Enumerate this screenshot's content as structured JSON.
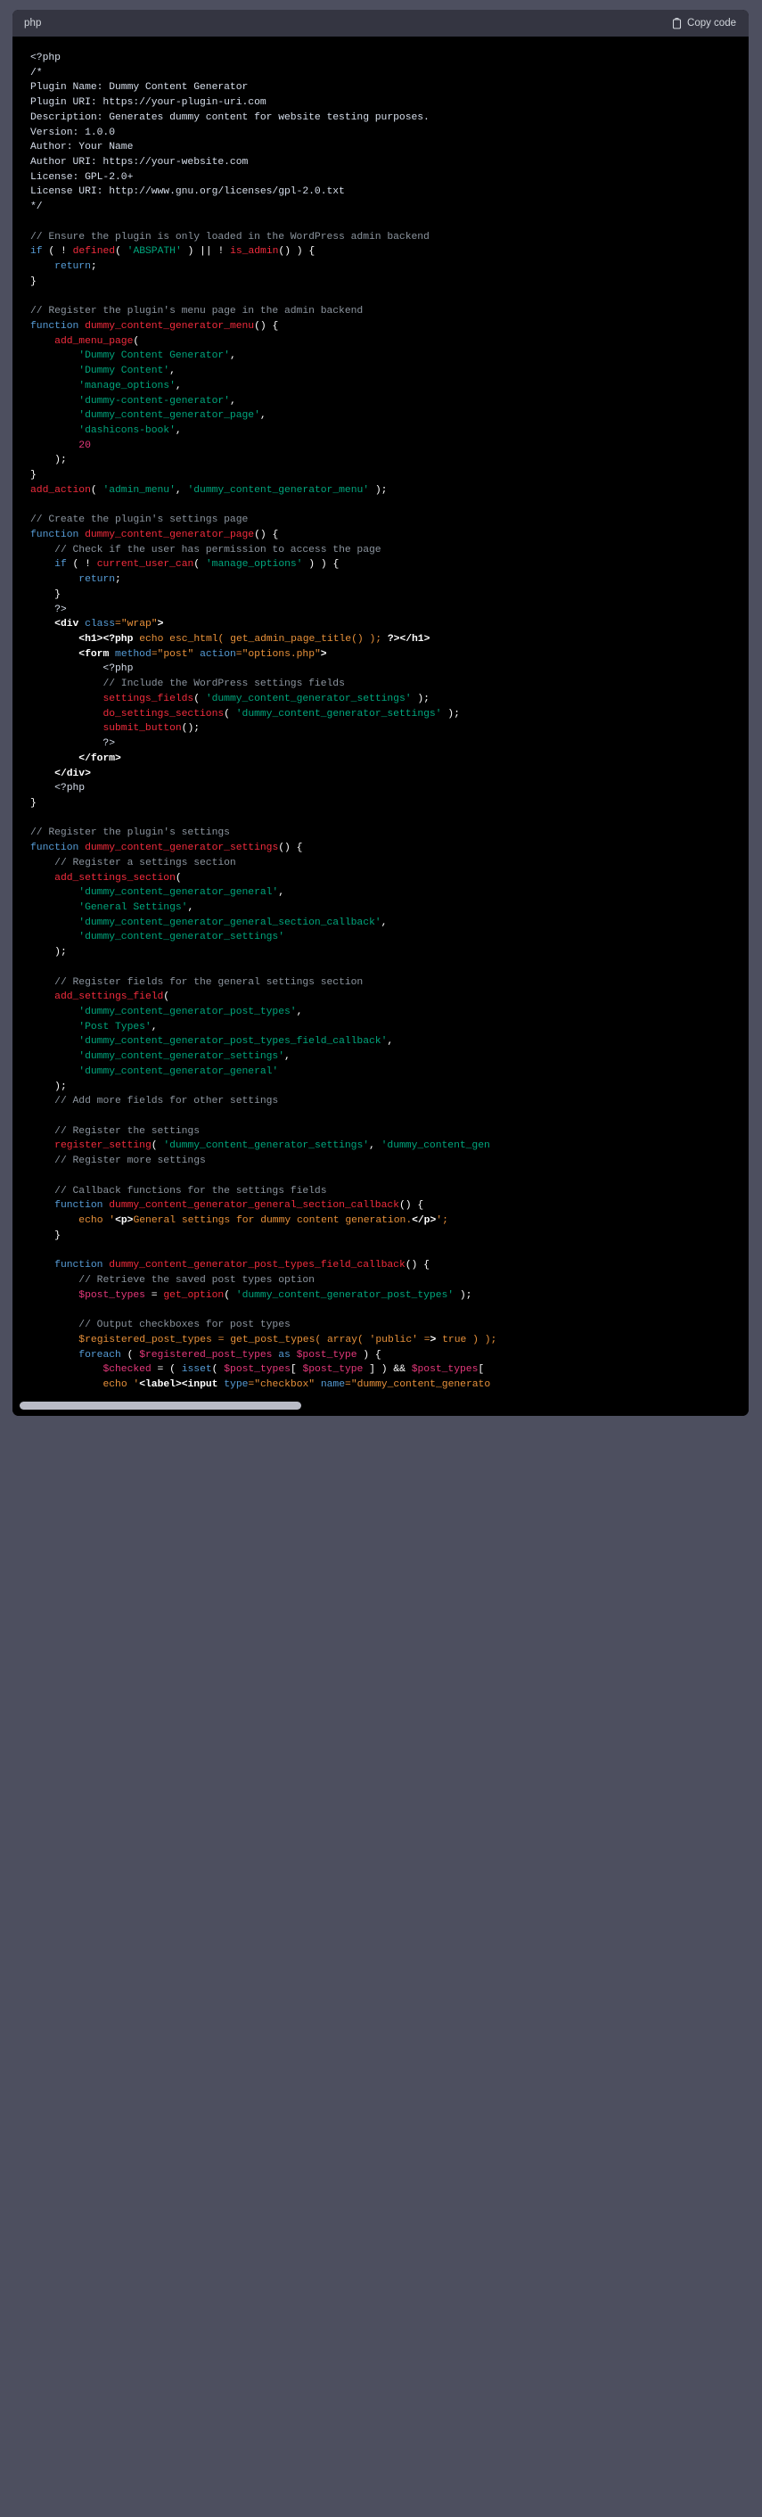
{
  "code_block": {
    "language_label": "php",
    "copy_label": "Copy code",
    "copy_icon": "clipboard-icon",
    "colors": {
      "page_background": "#4d4f5f",
      "header_background": "#343541",
      "body_background": "#000000",
      "comment": "#8b949e",
      "keyword": "#569cd6",
      "function": "#f22c3d",
      "string": "#00a67d",
      "number": "#e5387b",
      "variable": "#e5387b",
      "html_tag": "#ffffff",
      "html_attr": "#569cd6",
      "html_attr_value": "#e8913a",
      "plain_text": "#d6deeb",
      "scrollbar_thumb": "#b9bbc6"
    },
    "scrollbar": {
      "visible": true,
      "thumb_fraction": 0.39
    },
    "code_lines": [
      "<?php",
      "/*",
      "Plugin Name: Dummy Content Generator",
      "Plugin URI: https://your-plugin-uri.com",
      "Description: Generates dummy content for website testing purposes.",
      "Version: 1.0.0",
      "Author: Your Name",
      "Author URI: https://your-website.com",
      "License: GPL-2.0+",
      "License URI: http://www.gnu.org/licenses/gpl-2.0.txt",
      "*/",
      "",
      "// Ensure the plugin is only loaded in the WordPress admin backend",
      "if ( ! defined( 'ABSPATH' ) || ! is_admin() ) {",
      "    return;",
      "}",
      "",
      "// Register the plugin's menu page in the admin backend",
      "function dummy_content_generator_menu() {",
      "    add_menu_page(",
      "        'Dummy Content Generator',",
      "        'Dummy Content',",
      "        'manage_options',",
      "        'dummy-content-generator',",
      "        'dummy_content_generator_page',",
      "        'dashicons-book',",
      "        20",
      "    );",
      "}",
      "add_action( 'admin_menu', 'dummy_content_generator_menu' );",
      "",
      "// Create the plugin's settings page",
      "function dummy_content_generator_page() {",
      "    // Check if the user has permission to access the page",
      "    if ( ! current_user_can( 'manage_options' ) ) {",
      "        return;",
      "    }",
      "    ?>",
      "    <div class=\"wrap\">",
      "        <h1><?php echo esc_html( get_admin_page_title() ); ?></h1>",
      "        <form method=\"post\" action=\"options.php\">",
      "            <?php",
      "            // Include the WordPress settings fields",
      "            settings_fields( 'dummy_content_generator_settings' );",
      "            do_settings_sections( 'dummy_content_generator_settings' );",
      "            submit_button();",
      "            ?>",
      "        </form>",
      "    </div>",
      "    <?php",
      "}",
      "",
      "// Register the plugin's settings",
      "function dummy_content_generator_settings() {",
      "    // Register a settings section",
      "    add_settings_section(",
      "        'dummy_content_generator_general',",
      "        'General Settings',",
      "        'dummy_content_generator_general_section_callback',",
      "        'dummy_content_generator_settings'",
      "    );",
      "",
      "    // Register fields for the general settings section",
      "    add_settings_field(",
      "        'dummy_content_generator_post_types',",
      "        'Post Types',",
      "        'dummy_content_generator_post_types_field_callback',",
      "        'dummy_content_generator_settings',",
      "        'dummy_content_generator_general'",
      "    );",
      "    // Add more fields for other settings",
      "",
      "    // Register the settings",
      "    register_setting( 'dummy_content_generator_settings', 'dummy_content_gen",
      "    // Register more settings",
      "",
      "    // Callback functions for the settings fields",
      "    function dummy_content_generator_general_section_callback() {",
      "        echo '<p>General settings for dummy content generation.</p>';",
      "    }",
      "",
      "    function dummy_content_generator_post_types_field_callback() {",
      "        // Retrieve the saved post types option",
      "        $post_types = get_option( 'dummy_content_generator_post_types' );",
      "",
      "        // Output checkboxes for post types",
      "        $registered_post_types = get_post_types( array( 'public' => true ) );",
      "        foreach ( $registered_post_types as $post_type ) {",
      "            $checked = ( isset( $post_types[ $post_type ] ) && $post_types[",
      "            echo '<label><input type=\"checkbox\" name=\"dummy_content_generato"
    ]
  }
}
